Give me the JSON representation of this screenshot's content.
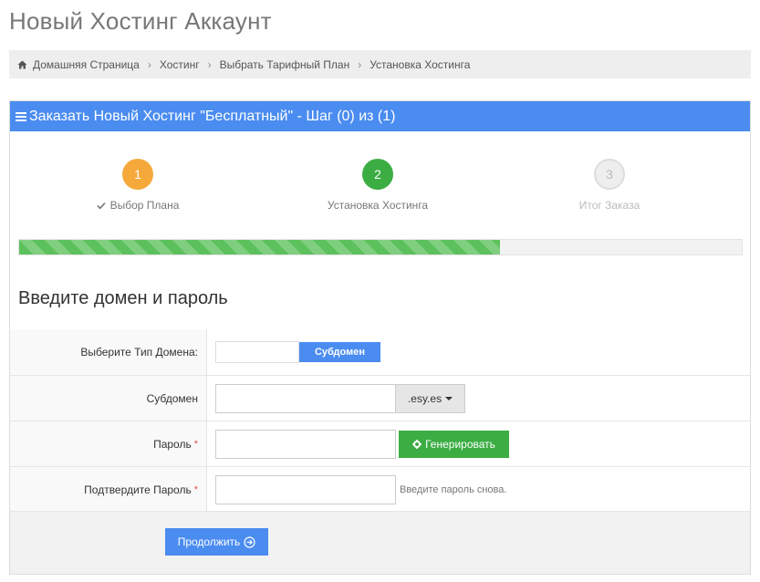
{
  "page": {
    "title": "Новый Хостинг Аккаунт"
  },
  "breadcrumb": {
    "items": [
      "Домашняя Страница",
      "Хостинг",
      "Выбрать Тарифный План",
      "Установка Хостинга"
    ],
    "separator": "›"
  },
  "panel": {
    "heading": "Заказать Новый Хостинг \"Бесплатный\" - Шаг (0) из (1)",
    "heading_color": "#4a8cf0"
  },
  "steps": [
    {
      "number": "1",
      "label": "Выбор Плана",
      "color": "#f5a93b",
      "text_color": "#ffffff",
      "done": true
    },
    {
      "number": "2",
      "label": "Установка Хостинга",
      "color": "#3cad43",
      "text_color": "#ffffff",
      "done": false
    },
    {
      "number": "3",
      "label": "Итог Заказа",
      "color": "#eeeeee",
      "text_color": "#bbbbbb",
      "done": false
    }
  ],
  "progress": {
    "fraction": 0.665,
    "color": "#5cc15c"
  },
  "form": {
    "section_title": "Введите домен и пароль",
    "domain_type_label": "Выберите Тип Домена:",
    "domain_type_value": "",
    "domain_type_button": "Субдомен",
    "subdomain_label": "Субдомен",
    "subdomain_value": "",
    "subdomain_suffix": ".esy.es",
    "password_label": "Пароль",
    "password_value": "",
    "required_mark": "*",
    "generate_button": "Генерировать",
    "confirm_label": "Подтвердите Пароль",
    "confirm_value": "",
    "confirm_help": "Введите пароль снова.",
    "continue_button": "Продолжить"
  },
  "colors": {
    "accent": "#4a8cf0",
    "success": "#3cad43",
    "warning": "#f5a93b",
    "required": "#d9534f"
  },
  "icons": {
    "home": "home-icon",
    "menu": "menu-icon",
    "check": "check-icon",
    "gear": "gear-icon",
    "arrow": "arrow-circle-right-icon"
  }
}
